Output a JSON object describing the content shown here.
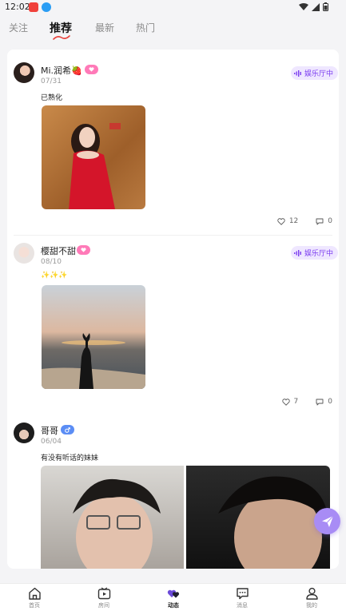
{
  "status_bar": {
    "time": "12:02"
  },
  "tabs": [
    {
      "label": "关注",
      "active": false
    },
    {
      "label": "推荐",
      "active": true
    },
    {
      "label": "最新",
      "active": false
    },
    {
      "label": "热门",
      "active": false
    }
  ],
  "colors": {
    "accent": "#7b3cf0",
    "chip_bg": "#efe7ff",
    "female_badge": "#ff7ab8",
    "male_badge": "#5b8df5",
    "fab": "#a88cf5"
  },
  "posts": [
    {
      "username": "Mi.润希🍓",
      "gender": "female",
      "date": "07/31",
      "status_chip": "娱乐厅中",
      "text": "已熟化",
      "likes": "12",
      "comments": "0"
    },
    {
      "username": "樱甜不甜",
      "gender": "female",
      "date": "08/10",
      "status_chip": "娱乐厅中",
      "text": "✨✨✨",
      "likes": "7",
      "comments": "0"
    },
    {
      "username": "哥哥",
      "gender": "male",
      "date": "06/04",
      "status_chip": "",
      "text": "有没有听话的妹妹",
      "likes": "",
      "comments": ""
    }
  ],
  "bottom_nav": [
    {
      "label": "首页",
      "icon": "home-icon",
      "active": false
    },
    {
      "label": "房间",
      "icon": "play-icon",
      "active": false
    },
    {
      "label": "动态",
      "icon": "hearts-icon",
      "active": true
    },
    {
      "label": "消息",
      "icon": "chat-icon",
      "active": false
    },
    {
      "label": "我的",
      "icon": "person-icon",
      "active": false
    }
  ]
}
